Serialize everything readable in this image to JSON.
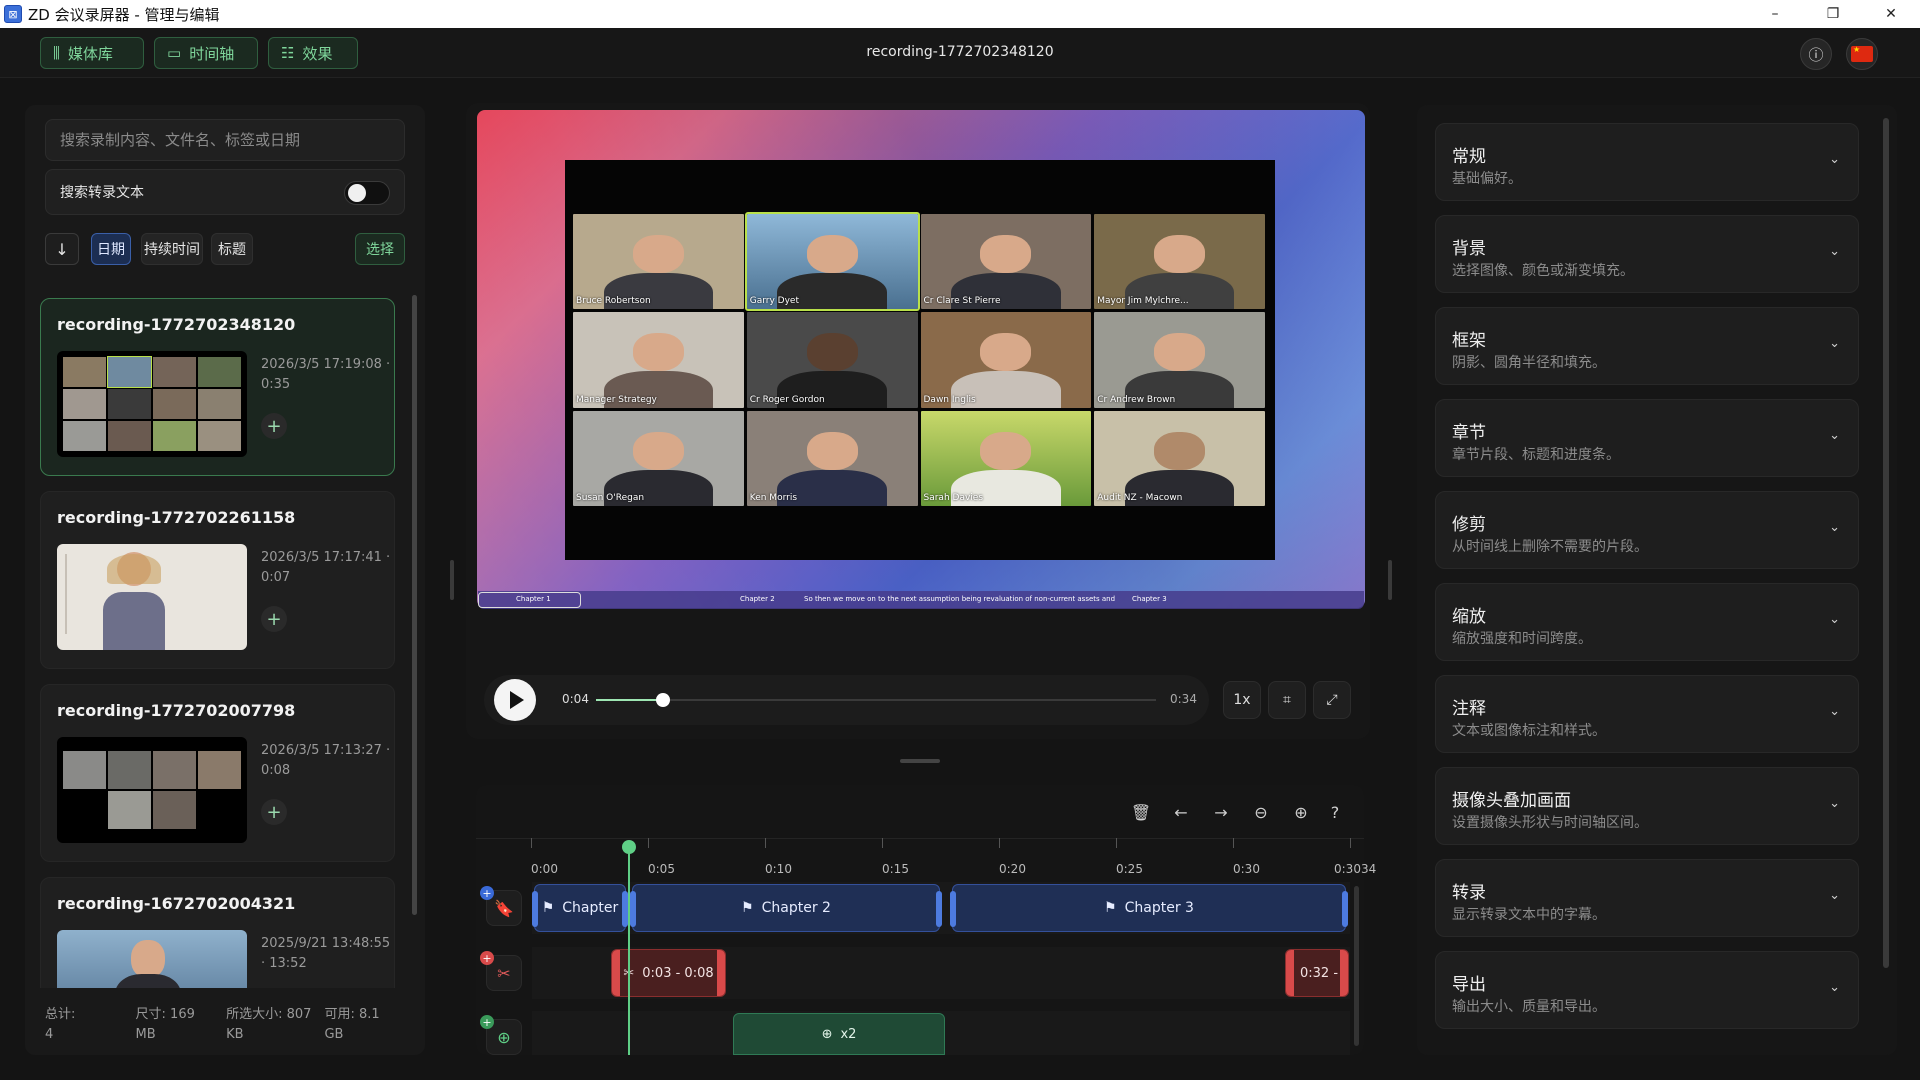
{
  "window": {
    "title": "ZD 会议录屏器 - 管理与编辑",
    "controls": [
      "–",
      "❐",
      "✕"
    ]
  },
  "toolbar": {
    "media_label": "媒体库",
    "timeline_label": "时间轴",
    "effects_label": "效果",
    "recording_title": "recording-1772702348120"
  },
  "library": {
    "search_placeholder": "搜索录制内容、文件名、标签或日期",
    "transcript_search_label": "搜索转录文本",
    "transcript_search_on": false,
    "sort_options": [
      "日期",
      "持续时间",
      "标题"
    ],
    "sort_active": "日期",
    "select_label": "选择",
    "recordings": [
      {
        "name": "recording-1772702348120",
        "date": "2026/3/5 17:19:08 ·",
        "duration": "0:35",
        "selected": true
      },
      {
        "name": "recording-1772702261158",
        "date": "2026/3/5 17:17:41 ·",
        "duration": "0:07",
        "selected": false
      },
      {
        "name": "recording-1772702007798",
        "date": "2026/3/5 17:13:27 ·",
        "duration": "0:08",
        "selected": false
      },
      {
        "name": "recording-1672702004321",
        "date": "2025/9/21 13:48:55",
        "duration": "· 13:52",
        "selected": false
      }
    ],
    "footer": {
      "total_label": "总计:",
      "total_value": "4",
      "size_label": "尺寸: 169",
      "size_unit": "MB",
      "selected_label": "所选大小: 807",
      "selected_unit": "KB",
      "available_label": "可用: 8.1",
      "available_unit": "GB"
    }
  },
  "preview": {
    "participants": [
      "Bruce Robertson",
      "Garry Dyet",
      "Cr Clare St Pierre",
      "Mayor Jim Mylchre...",
      "Manager Strategy",
      "Cr Roger Gordon",
      "Dawn Inglis",
      "Cr Andrew Brown",
      "Susan O'Regan",
      "Ken Morris",
      "Sarah Davies",
      "Audit NZ - Macown"
    ],
    "active_speaker": "Garry Dyet",
    "chapter_bar": {
      "chapter1": "Chapter 1",
      "chapter2": "Chapter 2",
      "caption": "So then we move on to the next assumption being revaluation of non-current assets and",
      "chapter3": "Chapter 3"
    }
  },
  "playback": {
    "current_time": "0:04",
    "total_time": "0:34",
    "progress": 0.12,
    "speed_label": "1x"
  },
  "timeline": {
    "ticks": [
      "0:00",
      "0:05",
      "0:10",
      "0:15",
      "0:20",
      "0:25",
      "0:30",
      "0:3034"
    ],
    "chapters": [
      {
        "label": "Chapter"
      },
      {
        "label": "Chapter 2"
      },
      {
        "label": "Chapter 3"
      }
    ],
    "trims": [
      {
        "label": "0:03 - 0:08"
      },
      {
        "label": "0:32 - ("
      }
    ],
    "zooms": [
      {
        "label": "x2"
      }
    ]
  },
  "settings": [
    {
      "title": "常规",
      "desc": "基础偏好。"
    },
    {
      "title": "背景",
      "desc": "选择图像、颜色或渐变填充。"
    },
    {
      "title": "框架",
      "desc": "阴影、圆角半径和填充。"
    },
    {
      "title": "章节",
      "desc": "章节片段、标题和进度条。"
    },
    {
      "title": "修剪",
      "desc": "从时间线上删除不需要的片段。"
    },
    {
      "title": "缩放",
      "desc": "缩放强度和时间跨度。"
    },
    {
      "title": "注释",
      "desc": "文本或图像标注和样式。"
    },
    {
      "title": "摄像头叠加画面",
      "desc": "设置摄像头形状与时间轴区间。"
    },
    {
      "title": "转录",
      "desc": "显示转录文本中的字幕。"
    },
    {
      "title": "导出",
      "desc": "输出大小、质量和导出。"
    }
  ],
  "colors": {
    "accent_green": "#7fd69b",
    "chapter_blue": "#1f2f55",
    "trim_red": "#d84a4a",
    "zoom_green": "#1f4a35"
  }
}
